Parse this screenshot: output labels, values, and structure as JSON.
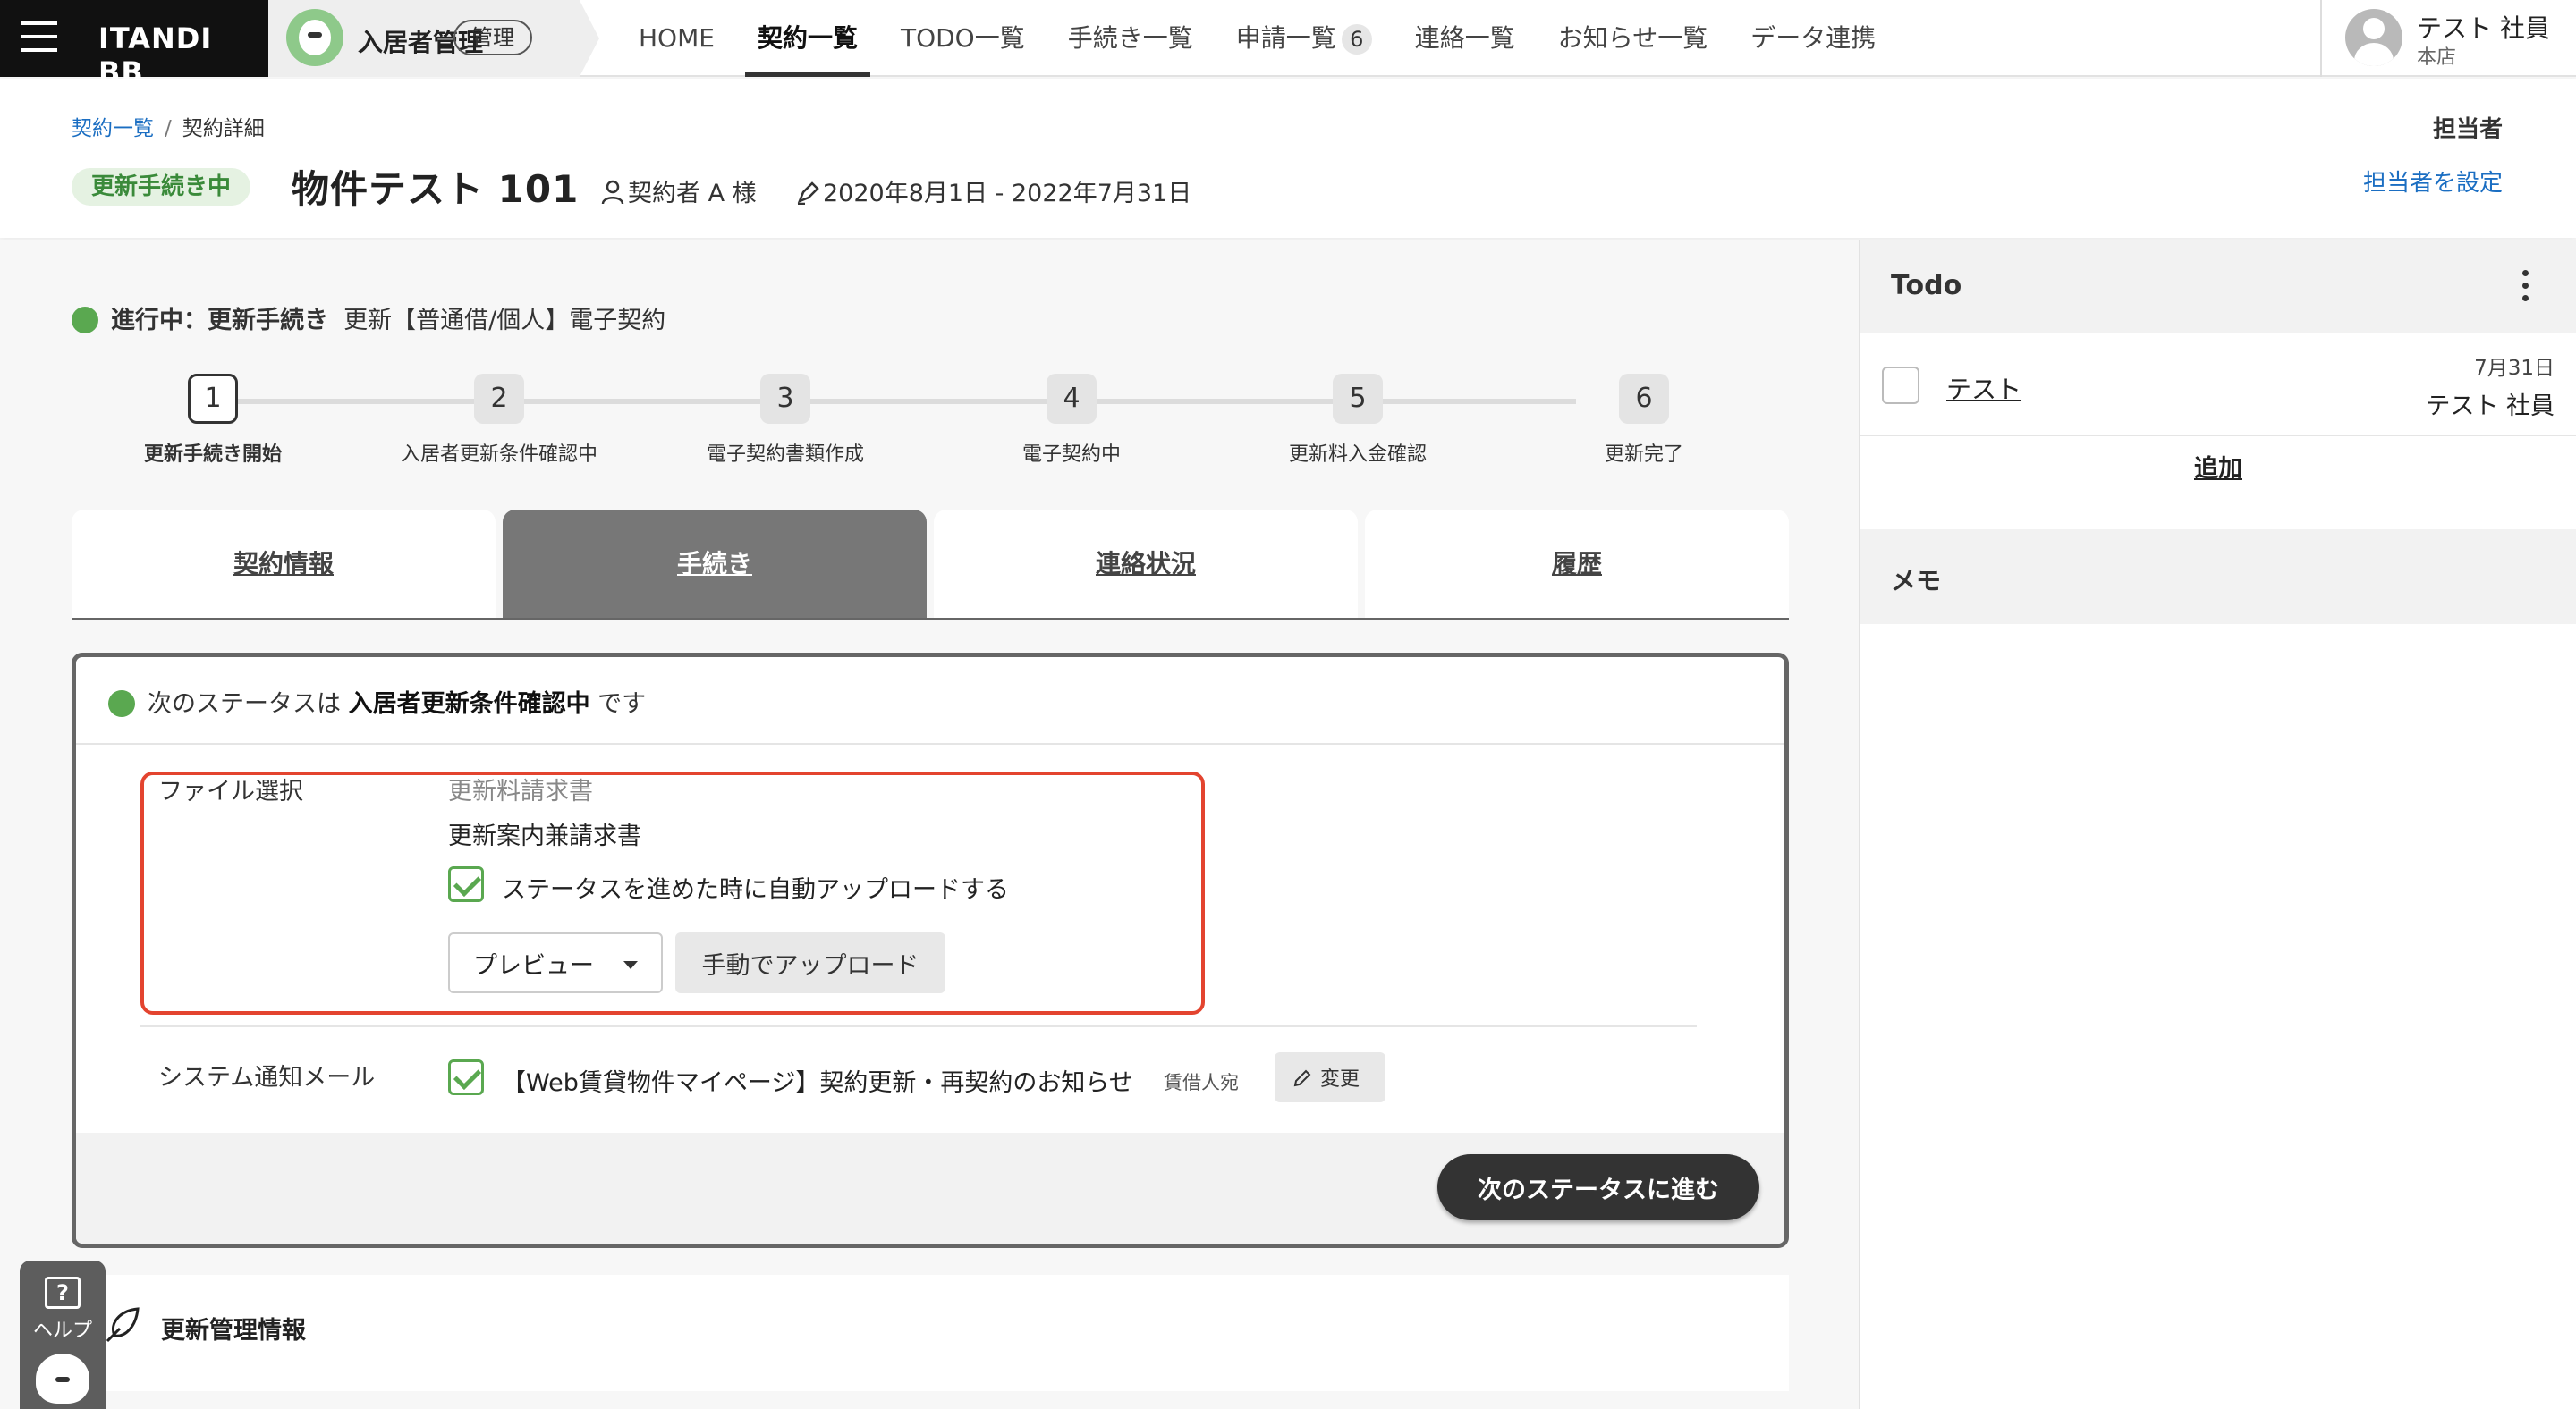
{
  "brand": {
    "name": "ITANDI BB"
  },
  "app": {
    "name": "入居者管理",
    "badge": "管理"
  },
  "nav": [
    {
      "label": "HOME"
    },
    {
      "label": "契約一覧",
      "active": true
    },
    {
      "label": "TODO一覧"
    },
    {
      "label": "手続き一覧"
    },
    {
      "label": "申請一覧",
      "count": "6"
    },
    {
      "label": "連絡一覧"
    },
    {
      "label": "お知らせ一覧"
    },
    {
      "label": "データ連携"
    }
  ],
  "user": {
    "name": "テスト 社員",
    "branch": "本店"
  },
  "breadcrumb": {
    "parent": "契約一覧",
    "separator": "/",
    "current": "契約詳細"
  },
  "contract": {
    "status": "更新手続き中",
    "title": "物件テスト 101",
    "tenant": "契約者 A 様",
    "period": "2020年8月1日 - 2022年7月31日"
  },
  "assignee": {
    "label": "担当者",
    "link": "担当者を設定"
  },
  "progress": {
    "prefix": "進行中：更新手続き",
    "detail": "更新【普通借/個人】電子契約"
  },
  "steps": [
    {
      "num": "1",
      "label": "更新手続き開始",
      "current": true
    },
    {
      "num": "2",
      "label": "入居者更新条件確認中"
    },
    {
      "num": "3",
      "label": "電子契約書類作成"
    },
    {
      "num": "4",
      "label": "電子契約中"
    },
    {
      "num": "5",
      "label": "更新料入金確認"
    },
    {
      "num": "6",
      "label": "更新完了"
    }
  ],
  "tabs": [
    {
      "label": "契約情報"
    },
    {
      "label": "手続き",
      "active": true
    },
    {
      "label": "連絡状況"
    },
    {
      "label": "履歴"
    }
  ],
  "panel": {
    "head_pre": "次のステータスは ",
    "head_status": "入居者更新条件確認中",
    "head_post": " です",
    "file_label": "ファイル選択",
    "file_old": "更新料請求書",
    "file_new": "更新案内兼請求書",
    "auto_upload": "ステータスを進めた時に自動アップロードする",
    "preview": "プレビュー",
    "manual_upload": "手動でアップロード",
    "mail_label": "システム通知メール",
    "mail_subject": "【Web賃貸物件マイページ】契約更新・再契約のお知らせ",
    "mail_recipient": "賃借人宛",
    "change": "変更",
    "next": "次のステータスに進む"
  },
  "renewal_section": {
    "title": "更新管理情報"
  },
  "help": {
    "label": "ヘルプ",
    "icon_glyph": "?"
  },
  "todo": {
    "title": "Todo",
    "item": {
      "text": "テスト",
      "date": "7月31日",
      "owner": "テスト 社員"
    },
    "add": "追加"
  },
  "memo": {
    "title": "メモ"
  },
  "colors": {
    "accent_green": "#5aa850",
    "highlight_red": "#e3442f",
    "link_blue": "#1b6ec2"
  }
}
